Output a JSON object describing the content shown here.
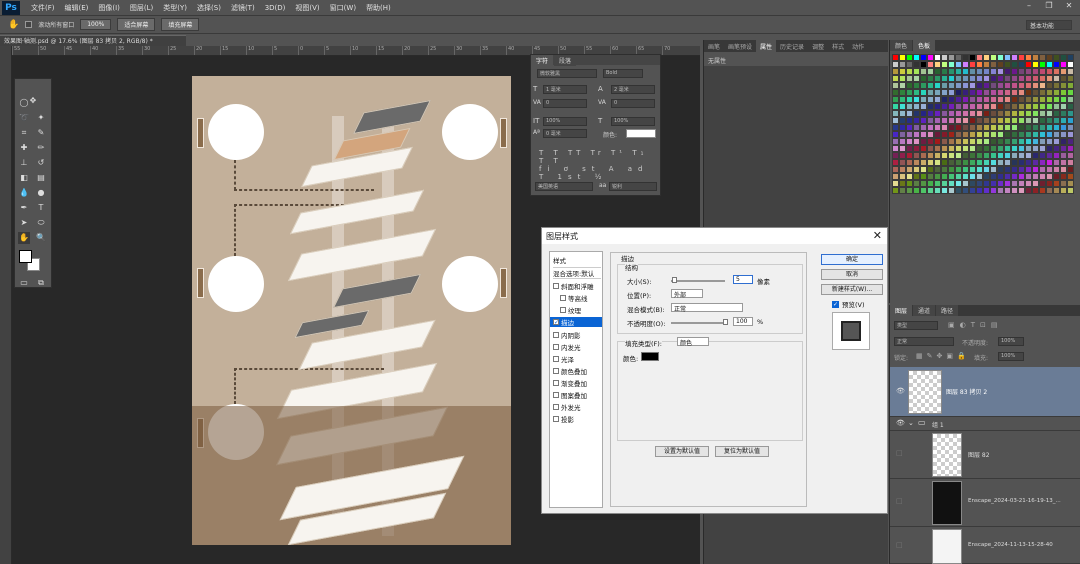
{
  "app": {
    "logo": "Ps"
  },
  "menu": [
    "文件(F)",
    "编辑(E)",
    "图像(I)",
    "图层(L)",
    "类型(Y)",
    "选择(S)",
    "滤镜(T)",
    "3D(D)",
    "视图(V)",
    "窗口(W)",
    "帮助(H)"
  ],
  "options_bar": {
    "scroll_all_windows": "滚动所有窗口",
    "zoom_100": "100%",
    "fit_screen": "适合屏幕",
    "fill_screen": "填充屏幕",
    "workspace": "基本功能"
  },
  "document_tab": "效果图·轴测.psd @ 17.6% (图层 83 拷贝 2, RGB/8) *",
  "ruler_marks": [
    "55",
    "50",
    "45",
    "40",
    "35",
    "30",
    "25",
    "20",
    "15",
    "10",
    "5",
    "0",
    "5",
    "10",
    "15",
    "20",
    "25",
    "30",
    "35",
    "40",
    "45",
    "50",
    "55",
    "60",
    "65",
    "70"
  ],
  "character_panel": {
    "tabs": [
      "字符",
      "段落"
    ],
    "font_family": "微软雅黑",
    "font_style": "Bold",
    "size": "1 毫米",
    "leading": "2 毫米",
    "kerning": "0",
    "tracking": "0",
    "vscale": "100%",
    "hscale": "100%",
    "baseline": "0 毫米",
    "color_label": "颜色:",
    "language": "美国英语",
    "antialias": "锐利"
  },
  "mid_panel": {
    "tabs": [
      "画笔",
      "画笔预设",
      "属性",
      "历史记录",
      "调整",
      "样式",
      "动作"
    ],
    "content_label": "无属性"
  },
  "swatches_panel": {
    "tabs": [
      "颜色",
      "色板"
    ]
  },
  "layers_panel": {
    "tabs": [
      "图层",
      "通道",
      "路径"
    ],
    "kind_filter": "类型",
    "blend_mode": "正常",
    "opacity_label": "不透明度:",
    "opacity": "100%",
    "lock_label": "锁定:",
    "fill_label": "填充:",
    "fill": "100%",
    "layers": [
      {
        "name": "图层 83 拷贝 2",
        "selected": true
      },
      {
        "name": "组 1",
        "group": true
      },
      {
        "name": "图层 82"
      },
      {
        "name": "Enscape_2024-03-21-16-19-13_..."
      },
      {
        "name": "Enscape_2024-11-13-15-28-40"
      }
    ]
  },
  "dialog": {
    "title": "图层样式",
    "styles_header": "样式",
    "blending_options": "混合选项:默认",
    "items": [
      {
        "label": "斜面和浮雕",
        "checked": false
      },
      {
        "label": "等高线",
        "checked": false,
        "indent": true
      },
      {
        "label": "纹理",
        "checked": false,
        "indent": true
      },
      {
        "label": "描边",
        "checked": true,
        "selected": true
      },
      {
        "label": "内阴影",
        "checked": false
      },
      {
        "label": "内发光",
        "checked": false
      },
      {
        "label": "光泽",
        "checked": false
      },
      {
        "label": "颜色叠加",
        "checked": false
      },
      {
        "label": "渐变叠加",
        "checked": false
      },
      {
        "label": "图案叠加",
        "checked": false
      },
      {
        "label": "外发光",
        "checked": false
      },
      {
        "label": "投影",
        "checked": false
      }
    ],
    "stroke": {
      "section": "描边",
      "structure": "结构",
      "size_label": "大小(S):",
      "size": "5",
      "size_unit": "像素",
      "position_label": "位置(P):",
      "position": "外部",
      "blend_label": "混合模式(B):",
      "blend": "正常",
      "opacity_label": "不透明度(O):",
      "opacity": "100",
      "opacity_unit": "%",
      "fill_type_label": "填充类型(F):",
      "fill_type": "颜色",
      "color_label": "颜色:",
      "color": "#000000"
    },
    "set_default": "设置为默认值",
    "reset_default": "复位为默认值",
    "ok": "确定",
    "cancel": "取消",
    "new_style": "新建样式(W)...",
    "preview": "预览(V)"
  }
}
